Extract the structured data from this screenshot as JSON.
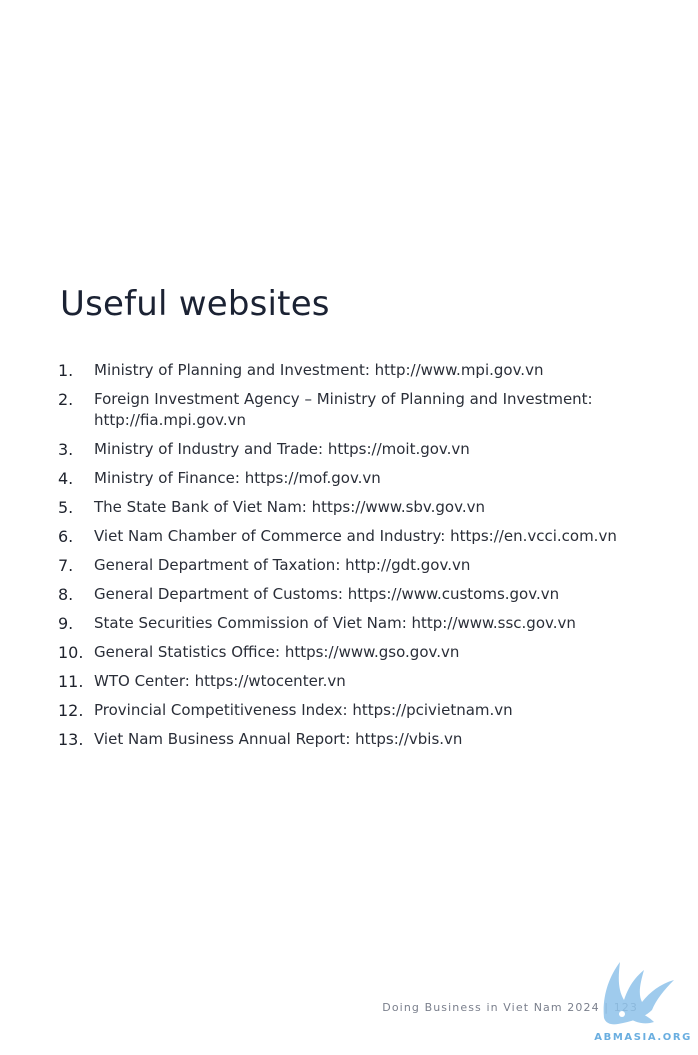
{
  "page": {
    "title": "Useful websites",
    "footer": "Doing Business in Viet Nam 2024 | 123",
    "watermark": "ABMASIA.ORG"
  },
  "websites": [
    {
      "num": "1.",
      "text": "Ministry of Planning and Investment: http://www.mpi.gov.vn"
    },
    {
      "num": "2.",
      "text": "Foreign Investment Agency – Ministry of Planning and Investment:\nhttp://fia.mpi.gov.vn"
    },
    {
      "num": "3.",
      "text": "Ministry of Industry and Trade: https://moit.gov.vn"
    },
    {
      "num": "4.",
      "text": "Ministry of Finance: https://mof.gov.vn"
    },
    {
      "num": "5.",
      "text": "The State Bank of Viet Nam: https://www.sbv.gov.vn"
    },
    {
      "num": "6.",
      "text": "Viet Nam Chamber of Commerce and Industry: https://en.vcci.com.vn"
    },
    {
      "num": "7.",
      "text": "General Department of Taxation: http://gdt.gov.vn"
    },
    {
      "num": "8.",
      "text": "General Department of Customs: https://www.customs.gov.vn"
    },
    {
      "num": "9.",
      "text": "State Securities Commission of Viet Nam: http://www.ssc.gov.vn"
    },
    {
      "num": "10.",
      "text": "General Statistics Office: https://www.gso.gov.vn"
    },
    {
      "num": "11.",
      "text": "WTO Center: https://wtocenter.vn"
    },
    {
      "num": "12.",
      "text": "Provincial Competitiveness Index: https://pcivietnam.vn"
    },
    {
      "num": "13.",
      "text": "Viet Nam Business Annual Report: https://vbis.vn"
    }
  ],
  "colors": {
    "title": "#1b2233",
    "body_text": "#2a2e38",
    "footer": "#7a7f8c",
    "watermark": "#6aaee0"
  }
}
